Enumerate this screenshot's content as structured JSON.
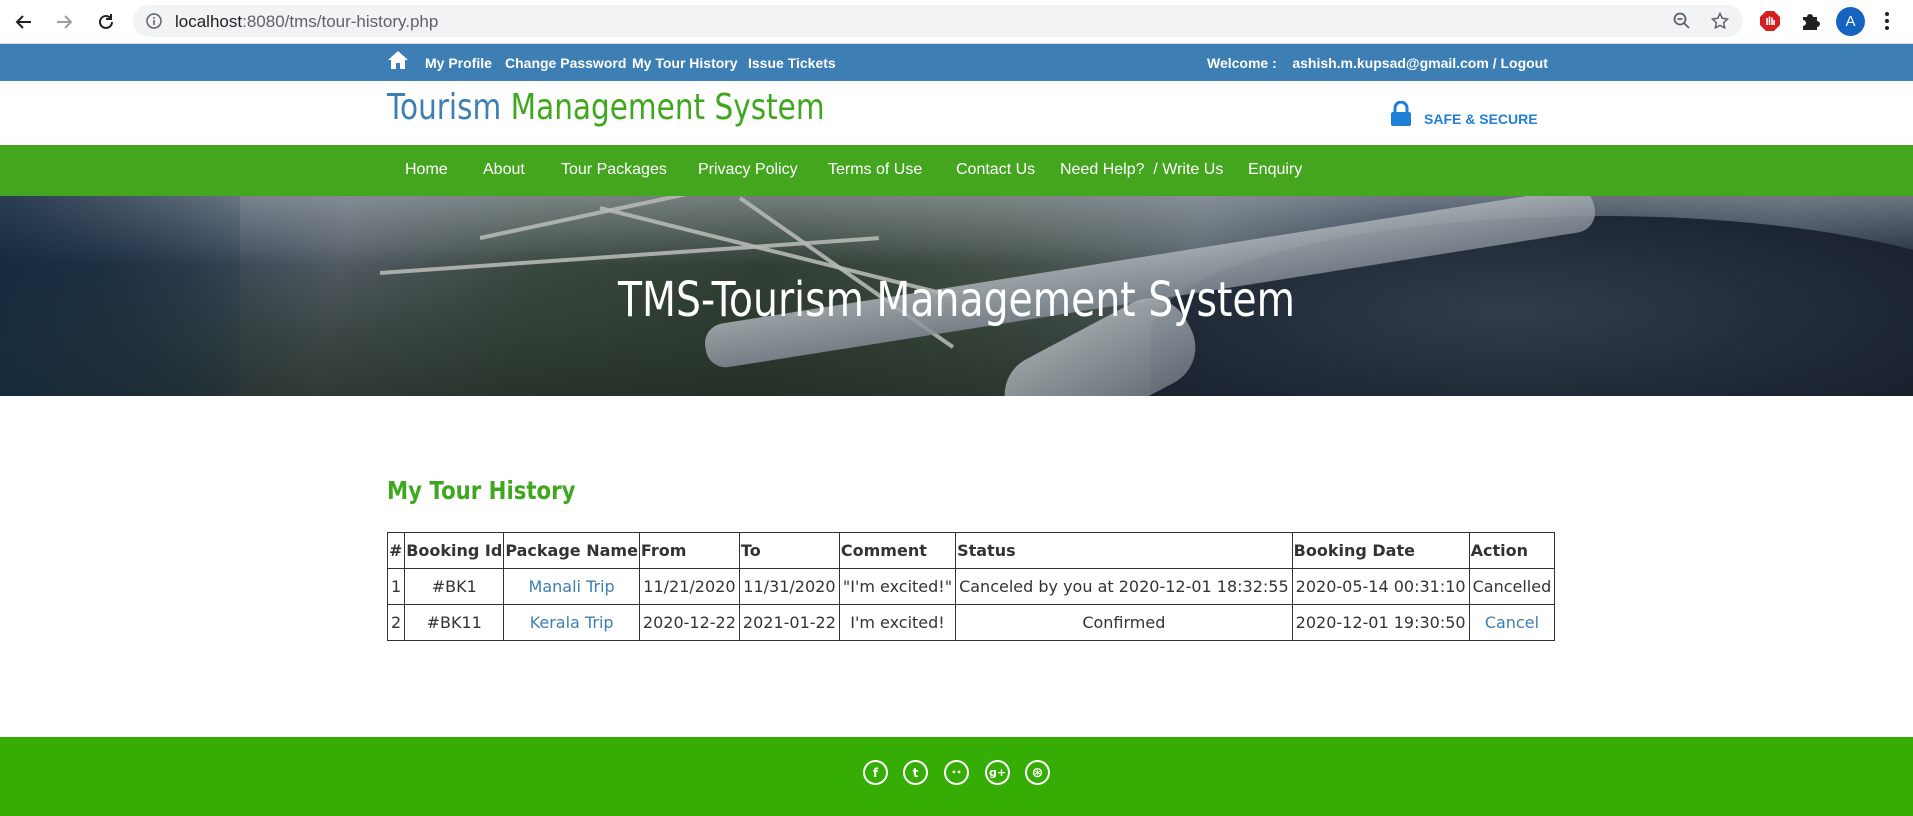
{
  "browser": {
    "url_host": "localhost",
    "url_rest": ":8080/tms/tour-history.php",
    "profile_initial": "A"
  },
  "topbar": {
    "links": [
      "My Profile",
      "Change Password",
      "My Tour History",
      "Issue Tickets"
    ],
    "welcome": "Welcome :    ashish.m.kupsad@gmail.com / Logout"
  },
  "header": {
    "logo_part1": "Tourism",
    "logo_part2": "Management System",
    "secure_label": "SAFE & SECURE"
  },
  "mainnav": {
    "items": [
      "Home",
      "About",
      "Tour Packages",
      "Privacy Policy",
      "Terms of Use",
      "Contact Us",
      "Need Help?  / Write Us",
      "Enquiry"
    ]
  },
  "banner": {
    "title": "TMS-Tourism Management System"
  },
  "content": {
    "title": "My Tour History",
    "table": {
      "headers": [
        "#",
        "Booking Id",
        "Package Name",
        "From",
        "To",
        "Comment",
        "Status",
        "Booking Date",
        "Action"
      ],
      "rows": [
        [
          "1",
          "#BK1",
          "Manali Trip",
          "11/21/2020",
          "11/31/2020",
          "\"I'm excited!\"",
          "Canceled by you at 2020-12-01 18:32:55",
          "2020-05-14 00:31:10",
          "Cancelled"
        ],
        [
          "2",
          "#BK11",
          "Kerala Trip",
          "2020-12-22",
          "2021-01-22",
          "I'm excited!",
          "Confirmed",
          "2020-12-01 19:30:50",
          "Cancel"
        ]
      ]
    }
  },
  "footer": {
    "social_icons": [
      "facebook-icon",
      "twitter-icon",
      "flickr-icon",
      "google-plus-icon",
      "dribbble-icon"
    ],
    "social_glyphs": [
      "f",
      "t",
      "••",
      "g+",
      "⊛"
    ]
  },
  "colors": {
    "topbar": "#3d7fb5",
    "nav_green": "#44a51f",
    "footer_green": "#36ad05",
    "link_blue": "#3d7fb5",
    "title_green": "#3fa71d"
  }
}
